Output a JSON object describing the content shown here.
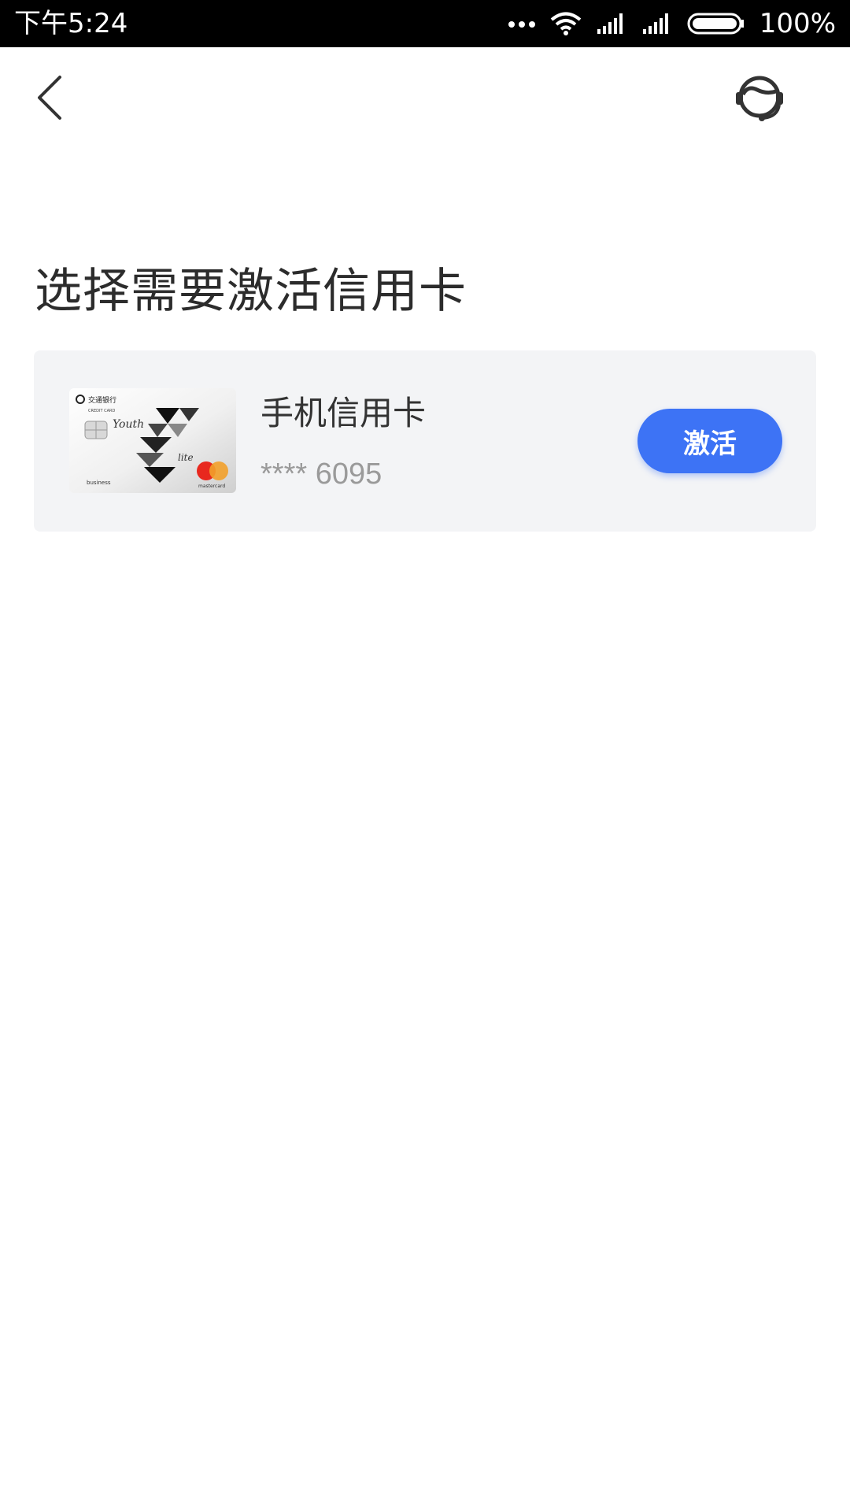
{
  "status_bar": {
    "time": "下午5:24",
    "battery": "100%",
    "icons": [
      "more-dots-icon",
      "wifi-icon",
      "signal-icon",
      "signal-icon",
      "battery-icon"
    ]
  },
  "header": {
    "back_icon": "chevron-left-icon",
    "support_icon": "customer-service-icon"
  },
  "page": {
    "title": "选择需要激活信用卡"
  },
  "card": {
    "name": "手机信用卡",
    "number": "**** 6095",
    "activate_label": "激活",
    "thumb_labels": {
      "brand_line": "交通银行",
      "credit_line": "CREDIT CARD",
      "youth": "Youth",
      "lite": "lite",
      "business": "business",
      "network": "mastercard"
    }
  },
  "colors": {
    "accent": "#3d73f5",
    "panel_bg": "#f3f4f6",
    "title_text": "#2c2c2c",
    "secondary_text": "#9a9a9a"
  }
}
